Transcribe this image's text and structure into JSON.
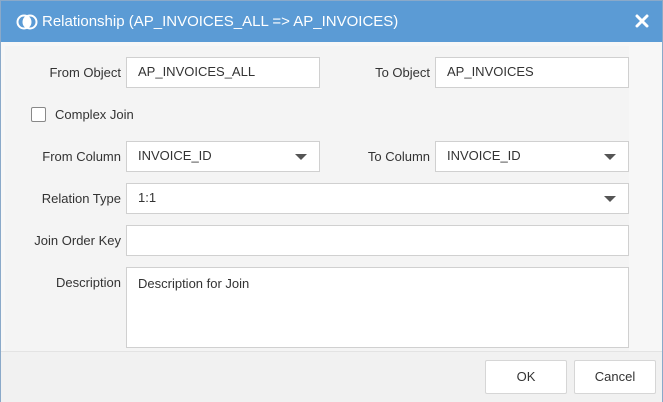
{
  "dialog": {
    "title": "Relationship (AP_INVOICES_ALL => AP_INVOICES)",
    "close_icon": "close-icon",
    "title_icon": "join-icon"
  },
  "form": {
    "from_object_label": "From Object",
    "from_object_value": "AP_INVOICES_ALL",
    "to_object_label": "To Object",
    "to_object_value": "AP_INVOICES",
    "complex_join_label": "Complex Join",
    "complex_join_checked": false,
    "from_column_label": "From Column",
    "from_column_value": "INVOICE_ID",
    "to_column_label": "To Column",
    "to_column_value": "INVOICE_ID",
    "relation_type_label": "Relation Type",
    "relation_type_value": "1:1",
    "join_order_key_label": "Join Order Key",
    "join_order_key_value": "",
    "description_label": "Description",
    "description_value": "Description for Join"
  },
  "footer": {
    "ok_label": "OK",
    "cancel_label": "Cancel"
  },
  "colors": {
    "titlebar": "#5b9bd5",
    "background": "#f4f4f4"
  }
}
